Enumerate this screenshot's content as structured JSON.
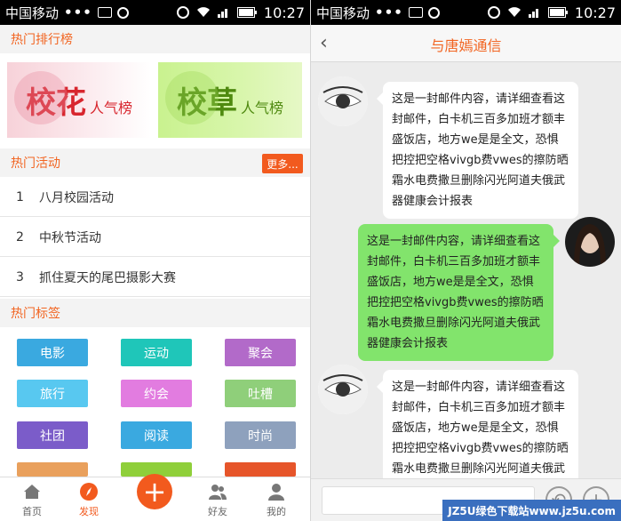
{
  "status_bar": {
    "carrier": "中国移动",
    "dots": "•••",
    "time": "10:27"
  },
  "left": {
    "section_rank": "热门排行榜",
    "banners": [
      {
        "main": "校花",
        "sub": "人气榜"
      },
      {
        "main": "校草",
        "sub": "人气榜"
      }
    ],
    "section_activity": "热门活动",
    "more_label": "更多...",
    "activities": [
      {
        "num": "1",
        "label": "八月校园活动"
      },
      {
        "num": "2",
        "label": "中秋节活动"
      },
      {
        "num": "3",
        "label": "抓住夏天的尾巴摄影大赛"
      }
    ],
    "section_tags": "热门标签",
    "tags": [
      {
        "label": "电影",
        "color": "#3aa9e0"
      },
      {
        "label": "运动",
        "color": "#1fc6b9"
      },
      {
        "label": "聚会",
        "color": "#b26ac9"
      },
      {
        "label": "旅行",
        "color": "#58c8f0"
      },
      {
        "label": "约会",
        "color": "#e27ce0"
      },
      {
        "label": "吐槽",
        "color": "#8fcf7a"
      },
      {
        "label": "社团",
        "color": "#7b5cc9"
      },
      {
        "label": "阅读",
        "color": "#3aa9e0"
      },
      {
        "label": "时尚",
        "color": "#8ea1bd"
      }
    ],
    "nav": {
      "home": "首页",
      "discover": "发现",
      "friends": "好友",
      "mine": "我的",
      "add": "+"
    }
  },
  "right": {
    "title": "与唐嫣通信",
    "back": "‹",
    "messages": [
      {
        "side": "left",
        "text": "这是一封邮件内容，请详细查看这封邮件，白卡机三百多加班才额丰盛饭店，地方we是是全文，恐惧把控把空格vivgb费vwes的擦防晒霜水电费撒旦删除闪光阿道夫俄武器健康会计报表"
      },
      {
        "side": "right",
        "text": "这是一封邮件内容，请详细查看这封邮件，白卡机三百多加班才额丰盛饭店，地方we是是全文，恐惧把控把空格vivgb费vwes的擦防晒霜水电费撒旦删除闪光阿道夫俄武器健康会计报表"
      },
      {
        "side": "left",
        "text": "这是一封邮件内容，请详细查看这封邮件，白卡机三百多加班才额丰盛饭店，地方we是是全文，恐惧把控把空格vivgb费vwes的擦防晒霜水电费撒旦删除闪光阿道夫俄武器健康会计报表"
      }
    ],
    "btn_undo": "↶",
    "btn_add": "+"
  },
  "watermark": "JZ5U绿色下载站www.jz5u.com"
}
